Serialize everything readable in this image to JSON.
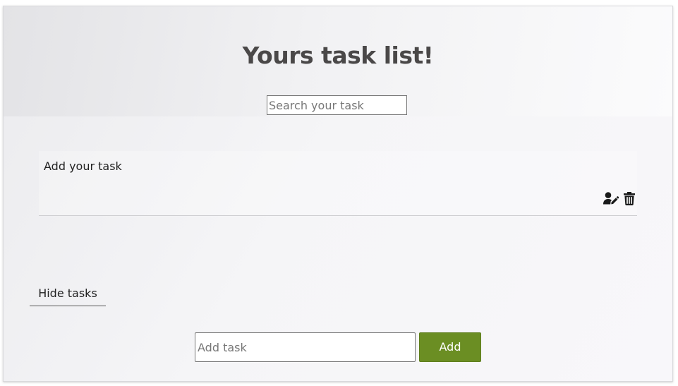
{
  "header": {
    "title": "Yours task list!"
  },
  "search": {
    "placeholder": "Search your task",
    "value": ""
  },
  "tasks": [
    {
      "text": "Add your task",
      "actions": [
        {
          "icon": "user-edit-icon"
        },
        {
          "icon": "trash-icon"
        }
      ]
    }
  ],
  "controls": {
    "hide_tasks_label": "Hide tasks",
    "add_task_placeholder": "Add task",
    "add_task_value": "",
    "add_label": "Add"
  },
  "colors": {
    "accent": "#6b8e23",
    "title": "#4a4848",
    "icon": "#1a1a1a"
  }
}
